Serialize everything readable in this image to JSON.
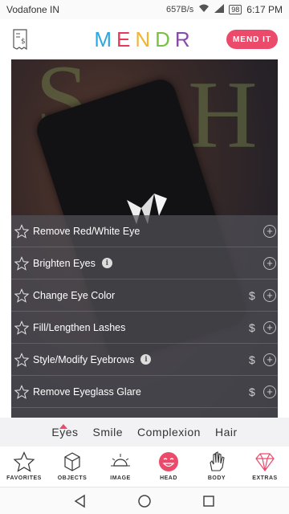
{
  "status_bar": {
    "carrier": "Vodafone IN",
    "net_speed": "657B/s",
    "battery": "98",
    "time": "6:17 PM"
  },
  "header": {
    "logo_letters": [
      "M",
      "E",
      "N",
      "D",
      "R"
    ],
    "logo_colors": [
      "#2aa9e0",
      "#e23b5b",
      "#f2b431",
      "#7ac043",
      "#8b4aa8"
    ],
    "mend_button_label": "MEND IT",
    "accent": "#ec4a6a"
  },
  "options": [
    {
      "label": "Remove Red/White Eye",
      "info": false,
      "paid": false
    },
    {
      "label": "Brighten Eyes",
      "info": true,
      "paid": false
    },
    {
      "label": "Change Eye Color",
      "info": false,
      "paid": true
    },
    {
      "label": "Fill/Lengthen Lashes",
      "info": false,
      "paid": true
    },
    {
      "label": "Style/Modify Eyebrows",
      "info": true,
      "paid": true
    },
    {
      "label": "Remove Eyeglass Glare",
      "info": false,
      "paid": true
    }
  ],
  "option_icons": {
    "favorite": "star-outline-icon",
    "info": "info-icon",
    "price": "$",
    "add": "+"
  },
  "category_tabs": [
    "Eyes",
    "Smile",
    "Complexion",
    "Hair"
  ],
  "active_category": "Eyes",
  "bottom_nav": [
    {
      "label": "FAVORITES",
      "icon": "star-icon"
    },
    {
      "label": "OBJECTS",
      "icon": "cube-icon"
    },
    {
      "label": "IMAGE",
      "icon": "sun-icon"
    },
    {
      "label": "HEAD",
      "icon": "face-icon"
    },
    {
      "label": "BODY",
      "icon": "hand-icon"
    },
    {
      "label": "EXTRAS",
      "icon": "diamond-icon"
    }
  ],
  "active_nav": "HEAD",
  "android_nav": [
    "back-icon",
    "home-icon",
    "recents-icon"
  ]
}
